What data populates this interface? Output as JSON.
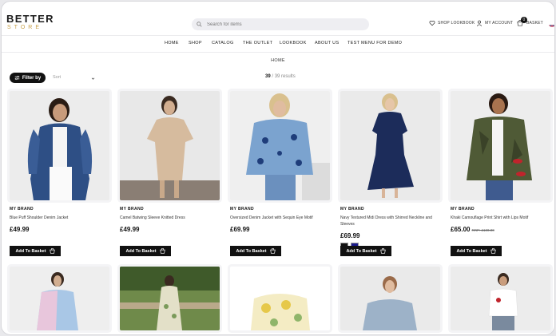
{
  "header": {
    "logo_top": "BETTER",
    "logo_bottom": "STORE",
    "search_placeholder": "Search for items",
    "shop_lookbook": "SHOP LOOKBOOK",
    "my_account": "MY ACCOUNT",
    "basket": "BASKET",
    "basket_count": "0"
  },
  "nav": [
    "HOME",
    "SHOP",
    "CATALOG",
    "THE OUTLET",
    "LOOKBOOK",
    "ABOUT US",
    "TEST MENU FOR DEMO"
  ],
  "breadcrumb": "HOME",
  "toolbar": {
    "filter_label": "Filter by",
    "sort_label": "Sort",
    "count_shown": "39",
    "count_total": "/ 39 results"
  },
  "basket_button_label": "Add To Basket",
  "products": [
    {
      "brand": "MY BRAND",
      "name": "Blue Puff Shoulder Denim Jacket",
      "price": "£49.99",
      "was": ""
    },
    {
      "brand": "MY BRAND",
      "name": "Camel Batwing Sleeve Knitted Dress",
      "price": "£49.99",
      "was": ""
    },
    {
      "brand": "MY BRAND",
      "name": "Oversized Denim Jacket with Sequin Eye Motif",
      "price": "£69.99",
      "was": ""
    },
    {
      "brand": "MY BRAND",
      "name": "Navy Textured Midi Dress with Shirred Neckline and Sleeves",
      "price": "£69.99",
      "was": ""
    },
    {
      "brand": "MY BRAND",
      "name": "Khaki Camouflage Print Shirt with Lips Motif",
      "price": "£65.00",
      "was": "RRP: £100.00"
    }
  ],
  "swatch_colors": [
    "#111111",
    "#1a1a8c"
  ]
}
